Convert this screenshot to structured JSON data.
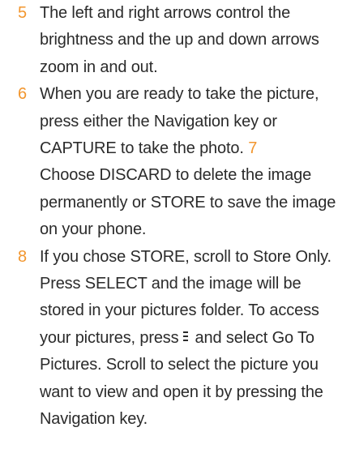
{
  "steps": [
    {
      "number": "5",
      "lines": [
        "The left and right arrows control the",
        "brightness and the up and down arrows",
        "zoom in and out."
      ]
    },
    {
      "number": "6",
      "line1": "When you are ready to take the picture,",
      "line2": "press either the Navigation key or",
      "line3_text": "CAPTURE to take the photo.",
      "line3_number": "7",
      "lines_rest": [
        "Choose DISCARD to delete the image",
        "permanently or STORE to save the image",
        "on your phone."
      ]
    },
    {
      "number": "8",
      "lines_before": [
        "If you chose STORE, scroll to Store Only.",
        "Press SELECT and the image will be",
        "stored in your pictures folder. To access"
      ],
      "icon_line_before": "your pictures, press",
      "icon": "menu-icon",
      "icon_line_after": "and select Go To",
      "lines_after": [
        "Pictures. Scroll to select the picture you",
        "want to view and open it by pressing the",
        "Navigation key."
      ]
    }
  ],
  "colors": {
    "step_number": "#f2962e",
    "text": "#2b2b2b"
  }
}
